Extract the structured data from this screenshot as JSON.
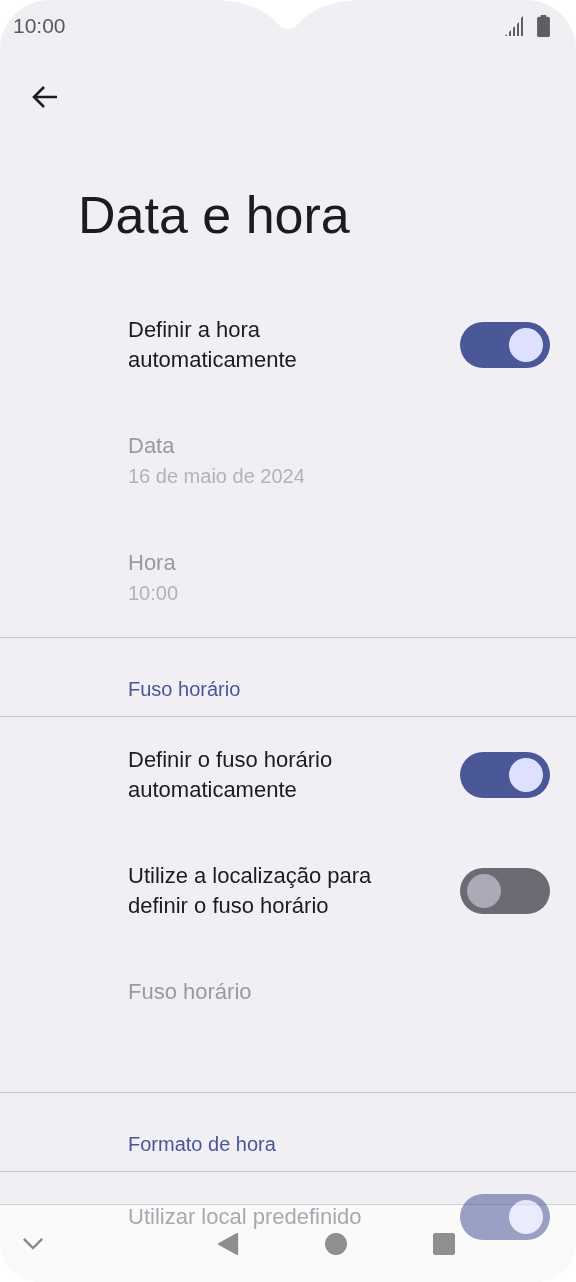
{
  "status_bar": {
    "time": "10:00"
  },
  "title": "Data e hora",
  "items": [
    {
      "kind": "toggle",
      "label": "Definir a hora automaticamente",
      "on": true
    },
    {
      "kind": "info",
      "label": "Data",
      "value": "16 de maio de 2024",
      "disabled": true
    },
    {
      "kind": "info",
      "label": "Hora",
      "value": "10:00",
      "disabled": true
    },
    {
      "kind": "header",
      "label": "Fuso horário"
    },
    {
      "kind": "toggle",
      "label": "Definir o fuso horário automaticamente",
      "on": true
    },
    {
      "kind": "toggle",
      "label": "Utilize a localização para definir o fuso horário",
      "on": false
    },
    {
      "kind": "info",
      "label": "Fuso horário",
      "disabled": true
    },
    {
      "kind": "header",
      "label": "Formato de hora"
    },
    {
      "kind": "toggle",
      "label": "Utilizar local predefinido",
      "on": true
    }
  ]
}
